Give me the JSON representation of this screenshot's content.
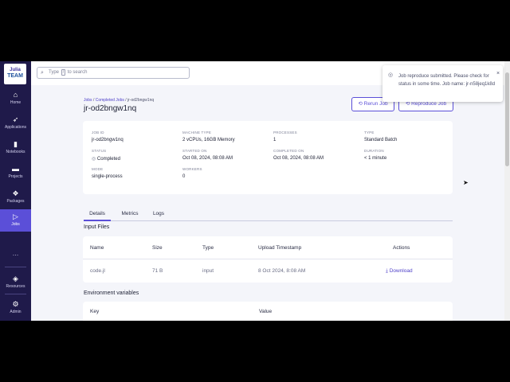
{
  "sidebar": {
    "logo_top": "Julia",
    "logo_bottom": "TEAM",
    "items": [
      {
        "label": "Home",
        "icon": "home-icon"
      },
      {
        "label": "Applications",
        "icon": "rocket-icon"
      },
      {
        "label": "Notebooks",
        "icon": "notebook-icon"
      },
      {
        "label": "Projects",
        "icon": "folder-icon"
      },
      {
        "label": "Packages",
        "icon": "packages-icon"
      },
      {
        "label": "Jobs",
        "icon": "play-icon",
        "active": true
      }
    ],
    "more": "…",
    "bottom_items": [
      {
        "label": "Resources",
        "icon": "resources-icon"
      },
      {
        "label": "Admin",
        "icon": "admin-icon"
      }
    ]
  },
  "search": {
    "prefix": "Type",
    "key": "/",
    "suffix": "to search"
  },
  "breadcrumb": {
    "jobs": "Jobs",
    "sep": "/",
    "completed": "Completed Jobs",
    "current": "jr-od2bngw1nq"
  },
  "page_title": "jr-od2bngw1nq",
  "buttons": {
    "rerun": "⟲ Rerun Job",
    "reproduce": "⟲ Reproduce Job"
  },
  "details": {
    "job_id_label": "JOB ID",
    "job_id": "jr-od2bngw1nq",
    "machine_label": "MACHINE TYPE",
    "machine": "2 vCPUs, 16GB Memory",
    "processes_label": "PROCESSES",
    "processes": "1",
    "type_label": "TYPE",
    "type": "Standard Batch",
    "status_label": "STATUS",
    "status": "Completed",
    "started_label": "STARTED ON",
    "started": "Oct 08, 2024, 08:08 AM",
    "completed_label": "COMPLETED ON",
    "completed": "Oct 08, 2024, 08:08 AM",
    "duration_label": "DURATION",
    "duration": "< 1 minute",
    "mode_label": "MODE",
    "mode": "single-process",
    "workers_label": "WORKERS",
    "workers": "0"
  },
  "tabs": [
    "Details",
    "Metrics",
    "Logs"
  ],
  "input_files": {
    "heading": "Input Files",
    "columns": [
      "Name",
      "Size",
      "Type",
      "Upload Timestamp",
      "Actions"
    ],
    "rows": [
      {
        "name": "code.jl",
        "size": "71 B",
        "type": "input",
        "timestamp": "8 Oct 2024, 8:08 AM",
        "action": "Download"
      }
    ]
  },
  "env": {
    "heading": "Environment variables",
    "columns": [
      "Key",
      "Value"
    ]
  },
  "toast": {
    "message": "Job reproduce submitted. Please check for status in some time. Job name: jr-n58jeq1k8d",
    "close": "×"
  },
  "colors": {
    "sidebar": "#1f1a4a",
    "accent": "#5b4fd8",
    "background": "#f4f5fa"
  }
}
